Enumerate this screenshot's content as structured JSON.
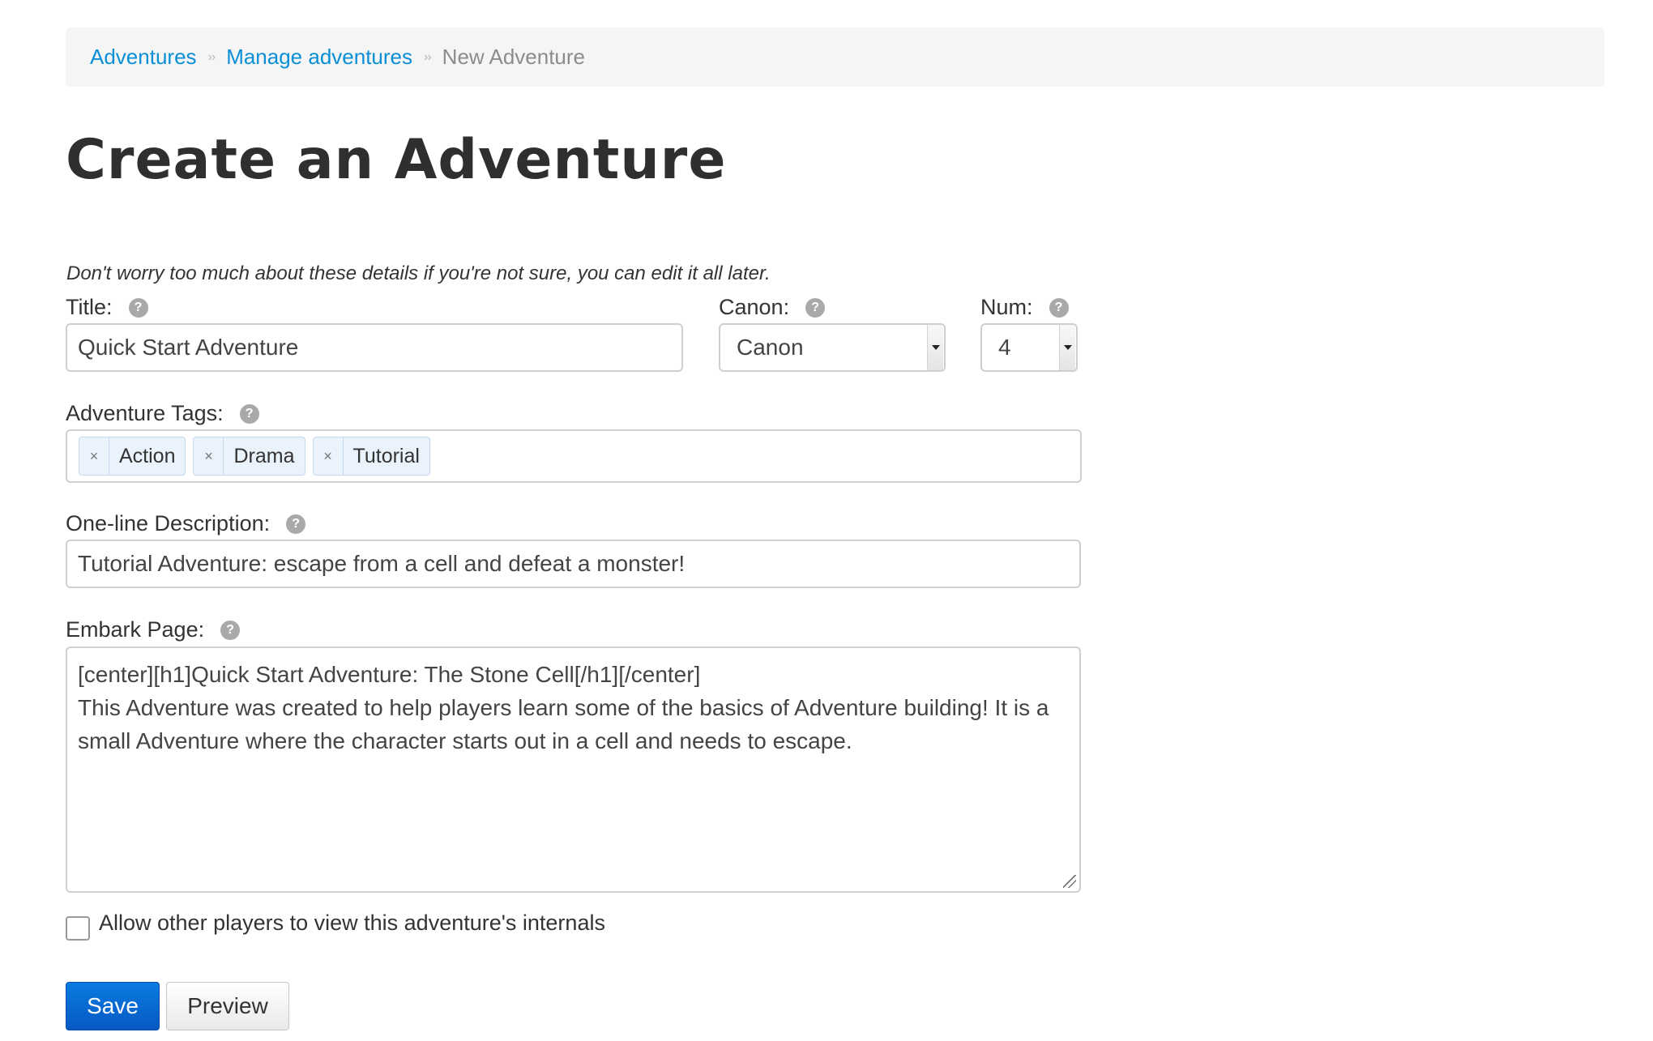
{
  "breadcrumb": {
    "items": [
      "Adventures",
      "Manage adventures"
    ],
    "current": "New Adventure",
    "separator": "››"
  },
  "page": {
    "title": "Create an Adventure",
    "intro": "Don't worry too much about these details if you're not sure, you can edit it all later."
  },
  "form": {
    "help_icon": "?",
    "title": {
      "label": "Title:",
      "value": "Quick Start Adventure"
    },
    "canon": {
      "label": "Canon:",
      "value": "Canon"
    },
    "num": {
      "label": "Num:",
      "value": "4"
    },
    "tags": {
      "label": "Adventure Tags:",
      "remove_glyph": "×",
      "items": [
        "Action",
        "Drama",
        "Tutorial"
      ]
    },
    "description": {
      "label": "One-line Description:",
      "value": "Tutorial Adventure: escape from a cell and defeat a monster!"
    },
    "embark": {
      "label": "Embark Page:",
      "value": "[center][h1]Quick Start Adventure: The Stone Cell[/h1][/center]\nThis Adventure was created to help players learn some of the basics of Adventure building! It is a small Adventure where the character starts out in a cell and needs to escape."
    },
    "allow_internals": {
      "label": "Allow other players to view this adventure's internals",
      "checked": false
    }
  },
  "buttons": {
    "save": "Save",
    "preview": "Preview"
  },
  "colors": {
    "link": "#0a8fd6",
    "primary": "#0759c4",
    "tag_bg": "#eaf2fc"
  },
  "icons": {
    "help": "help-icon",
    "tag_remove": "close-icon",
    "select_arrow": "chevron-down-icon"
  }
}
